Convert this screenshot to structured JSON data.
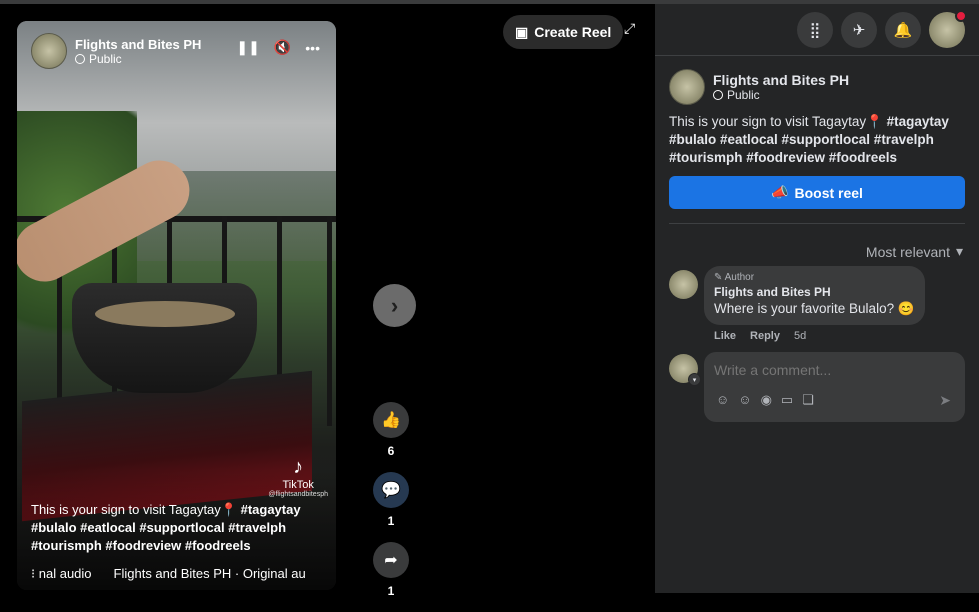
{
  "page": {
    "create_reel": "Create Reel",
    "expand_icon": "expand-icon",
    "next_icon": "chevron-right-icon"
  },
  "video": {
    "author": "Flights and Bites PH",
    "privacy": "Public",
    "caption_text": "This is your sign to visit Tagaytay📍",
    "caption_tags": "#tagaytay #bulalo #eatlocal #supportlocal #travelph #tourismph #foodreview #foodreels",
    "tiktok_label": "TikTok",
    "tiktok_handle": "@flightsandbitesph",
    "audio_partial": "nal audio",
    "audio_track": "Flights and Bites PH · Original au"
  },
  "actions": {
    "likes": "6",
    "comments": "1",
    "shares": "1"
  },
  "panel": {
    "author": "Flights and Bites PH",
    "privacy": "Public",
    "caption_text": "This is your sign to visit Tagaytay📍",
    "caption_tags": "#tagaytay #bulalo #eatlocal #supportlocal #travelph #tourismph #foodreview #foodreels",
    "boost_label": "Boost reel",
    "sort_label": "Most relevant",
    "comment": {
      "tag": "Author",
      "name": "Flights and Bites PH",
      "text": "Where is your favorite Bulalo? 😊",
      "like": "Like",
      "reply": "Reply",
      "time": "5d"
    },
    "write_placeholder": "Write a comment..."
  },
  "colors": {
    "accent": "#1b74e4",
    "panel_bg": "#242526",
    "badge": "#e41e3f"
  }
}
